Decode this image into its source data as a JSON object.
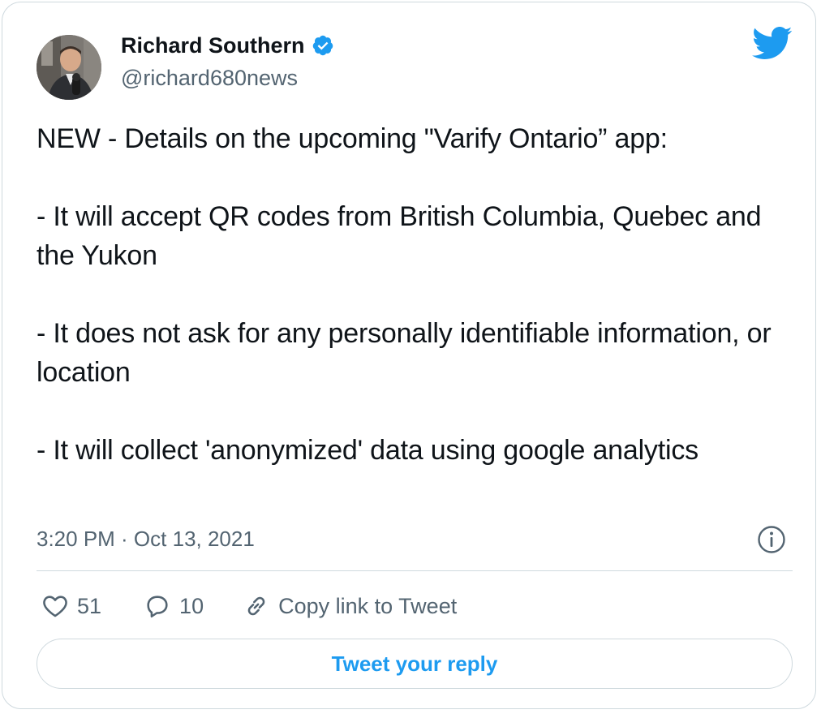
{
  "author": {
    "name": "Richard Southern",
    "handle": "@richard680news",
    "verified": true,
    "avatar_icon": "user-avatar-photo"
  },
  "tweet": {
    "text": "NEW - Details on the upcoming \"Varify Ontario” app:\n\n- It will accept QR codes from British Columbia, Quebec and the Yukon\n\n- It does not ask for any personally identifiable information, or location\n\n- It will collect 'anonymized' data using google analytics",
    "timestamp": "3:20 PM · Oct 13, 2021"
  },
  "actions": {
    "like_count": "51",
    "reply_count": "10",
    "copy_link_label": "Copy link to Tweet"
  },
  "reply_button_label": "Tweet your reply",
  "icons": {
    "brand": "twitter-bird-icon",
    "verified": "verified-badge-icon",
    "info": "info-icon",
    "like": "heart-icon",
    "reply": "speech-bubble-icon",
    "link": "link-icon"
  },
  "colors": {
    "brand_blue": "#1d9bf0",
    "text": "#0f1419",
    "secondary_text": "#536471",
    "border": "#cfd9de"
  }
}
